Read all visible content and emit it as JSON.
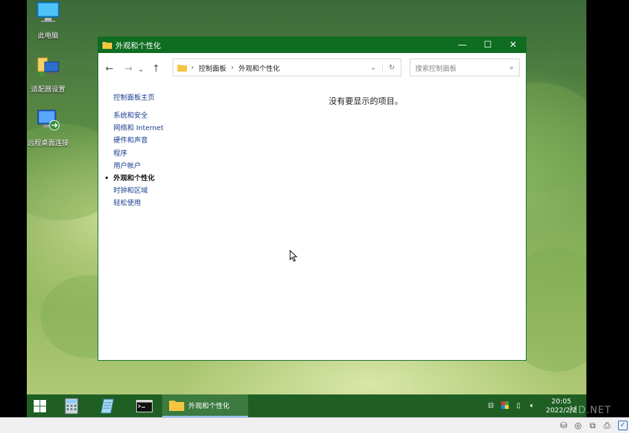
{
  "desktop": {
    "icons": [
      {
        "label": "此电脑",
        "icon": "computer-icon"
      },
      {
        "label": "适配器设置",
        "icon": "network-adapter-icon"
      },
      {
        "label": "远程桌面连接",
        "icon": "remote-desktop-icon"
      }
    ]
  },
  "window": {
    "title": "外观和个性化",
    "controls": {
      "minimize": "—",
      "maximize": "☐",
      "close": "✕"
    },
    "nav": {
      "back": "←",
      "forward": "→",
      "recent": "⌄",
      "up": "↑"
    },
    "address": {
      "crumbs": [
        "控制面板",
        "外观和个性化"
      ],
      "separator": "›",
      "dropdown": "⌄",
      "refresh": "↻"
    },
    "search": {
      "placeholder": "搜索控制面板",
      "icon": "⌕"
    },
    "sidebar": {
      "home": "控制面板主页",
      "items": [
        {
          "label": "系统和安全",
          "active": false
        },
        {
          "label": "网络和 Internet",
          "active": false
        },
        {
          "label": "硬件和声音",
          "active": false
        },
        {
          "label": "程序",
          "active": false
        },
        {
          "label": "用户帐户",
          "active": false
        },
        {
          "label": "外观和个性化",
          "active": true
        },
        {
          "label": "时钟和区域",
          "active": false
        },
        {
          "label": "轻松使用",
          "active": false
        }
      ]
    },
    "empty_message": "没有要显示的项目。"
  },
  "taskbar": {
    "apps": [
      {
        "name": "start",
        "icon": "windows-logo-icon"
      },
      {
        "name": "calculator",
        "icon": "calculator-icon"
      },
      {
        "name": "notepad",
        "icon": "notepad-icon"
      },
      {
        "name": "cmd",
        "icon": "terminal-icon"
      }
    ],
    "active_window": "外观和个性化",
    "tray_icons": [
      "network-icon",
      "color-icon",
      "usb-icon",
      "volume-icon"
    ],
    "time": "20:05",
    "date": "2022/2/2"
  },
  "watermark": "MD.NET",
  "colors": {
    "titlebar": "#0f6d21",
    "taskbar": "#1f5f24",
    "link": "#1a3e8f"
  }
}
